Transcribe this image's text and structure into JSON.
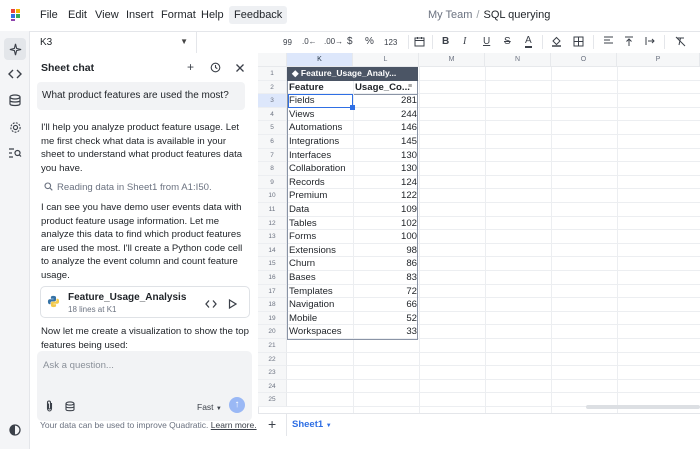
{
  "menu": {
    "items": [
      "File",
      "Edit",
      "View",
      "Insert",
      "Format",
      "Help",
      "Feedback"
    ]
  },
  "breadcrumb": {
    "team": "My Team",
    "separator": "/",
    "file": "SQL querying"
  },
  "namebox": {
    "value": "K3"
  },
  "toolbar": {
    "items": [
      "99",
      ".0←",
      ".00→",
      "$",
      "%",
      "123"
    ]
  },
  "chat": {
    "title": "Sheet chat",
    "user_message": "What product features are used the most?",
    "para1": [
      "I'll help you analyze product feature usage. Let",
      "me first check what data is available in your",
      "sheet to understand what product features data",
      "you have."
    ],
    "tool_status": "Reading data in Sheet1 from A1:I50.",
    "para2": [
      "I can see you have demo user events data with",
      "product feature usage information. Let me",
      "analyze this data to find which product features",
      "are used the most. I'll create a Python code cell",
      "to analyze the event column and count feature",
      "usage."
    ],
    "code_card": {
      "title": "Feature_Usage_Analysis",
      "subtitle": "18 lines at K1"
    },
    "para3": [
      "Now let me create a visualization to show the top",
      "features being used:"
    ],
    "input_placeholder": "Ask a question...",
    "model": "Fast",
    "footnote": "Your data can be used to improve Quadratic.",
    "footnote_link": "Learn more."
  },
  "grid": {
    "columns": [
      "K",
      "L",
      "M",
      "N",
      "O",
      "P"
    ],
    "rows": [
      "1",
      "2",
      "3",
      "4",
      "5",
      "6",
      "7",
      "8",
      "9",
      "10",
      "11",
      "12",
      "13",
      "14",
      "15",
      "16",
      "17",
      "18",
      "19",
      "20",
      "21",
      "22",
      "23",
      "24",
      "25"
    ],
    "table_name": "Feature_Usage_Analy...",
    "header": {
      "feature": "Feature",
      "usage": "Usage_Co..."
    },
    "data": [
      {
        "feature": "Fields",
        "usage": "281"
      },
      {
        "feature": "Views",
        "usage": "244"
      },
      {
        "feature": "Automations",
        "usage": "146"
      },
      {
        "feature": "Integrations",
        "usage": "145"
      },
      {
        "feature": "Interfaces",
        "usage": "130"
      },
      {
        "feature": "Collaboration",
        "usage": "130"
      },
      {
        "feature": "Records",
        "usage": "124"
      },
      {
        "feature": "Premium",
        "usage": "122"
      },
      {
        "feature": "Data",
        "usage": "109"
      },
      {
        "feature": "Tables",
        "usage": "102"
      },
      {
        "feature": "Forms",
        "usage": "100"
      },
      {
        "feature": "Extensions",
        "usage": "98"
      },
      {
        "feature": "Churn",
        "usage": "86"
      },
      {
        "feature": "Bases",
        "usage": "83"
      },
      {
        "feature": "Templates",
        "usage": "72"
      },
      {
        "feature": "Navigation",
        "usage": "66"
      },
      {
        "feature": "Mobile",
        "usage": "52"
      },
      {
        "feature": "Workspaces",
        "usage": "33"
      }
    ]
  },
  "sheet_tab": {
    "name": "Sheet1"
  },
  "colors": {
    "accent": "#2f6fe4",
    "table_header": "#4b5565",
    "send": "#9ab8f5"
  }
}
